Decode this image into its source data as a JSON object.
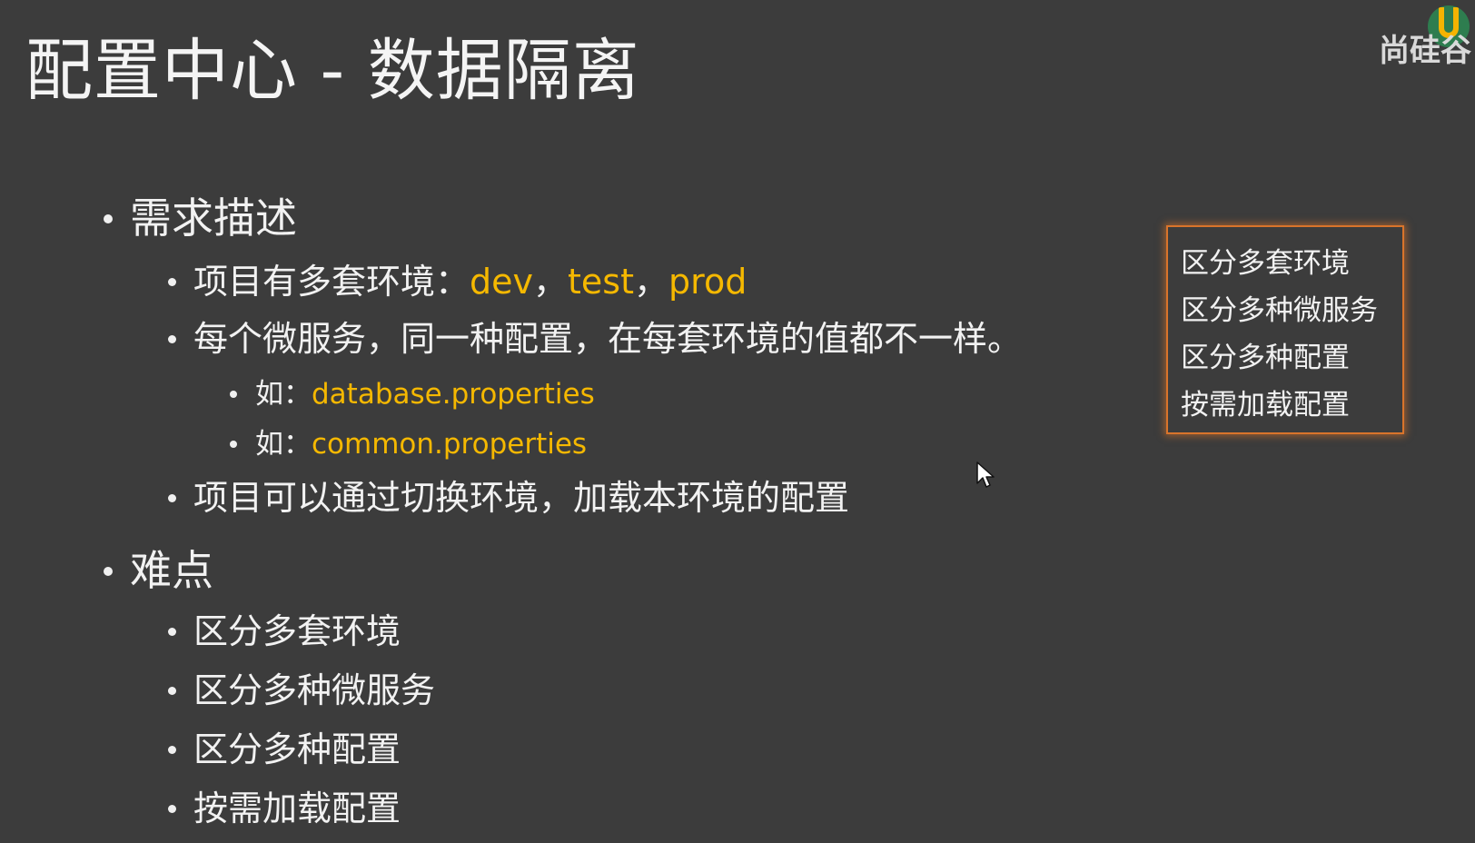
{
  "slide": {
    "title": "配置中心 -  数据隔离",
    "logo_text": "尚硅谷",
    "sections": {
      "requirements": {
        "heading": "需求描述",
        "env_line": {
          "label": "项目有多套环境：",
          "envs": [
            "dev",
            "test",
            "prod"
          ],
          "separators": [
            "，",
            "，"
          ]
        },
        "microservice_line": "每个微服务，同一种配置，在每套环境的值都不一样。",
        "examples": [
          {
            "prefix": "如：",
            "value": "database.properties"
          },
          {
            "prefix": "如：",
            "value": "common.properties"
          }
        ],
        "switch_line": "项目可以通过切换环境，加载本环境的配置"
      },
      "difficulties": {
        "heading": "难点",
        "items": [
          "区分多套环境",
          "区分多种微服务",
          "区分多种配置",
          "按需加载配置"
        ]
      }
    },
    "callout": {
      "items": [
        "区分多套环境",
        "区分多种微服务",
        "区分多种配置",
        "按需加载配置"
      ],
      "border_color": "#d9742b"
    },
    "colors": {
      "background": "#3c3c3c",
      "text": "#f2f2f2",
      "highlight": "#f5b800"
    }
  }
}
